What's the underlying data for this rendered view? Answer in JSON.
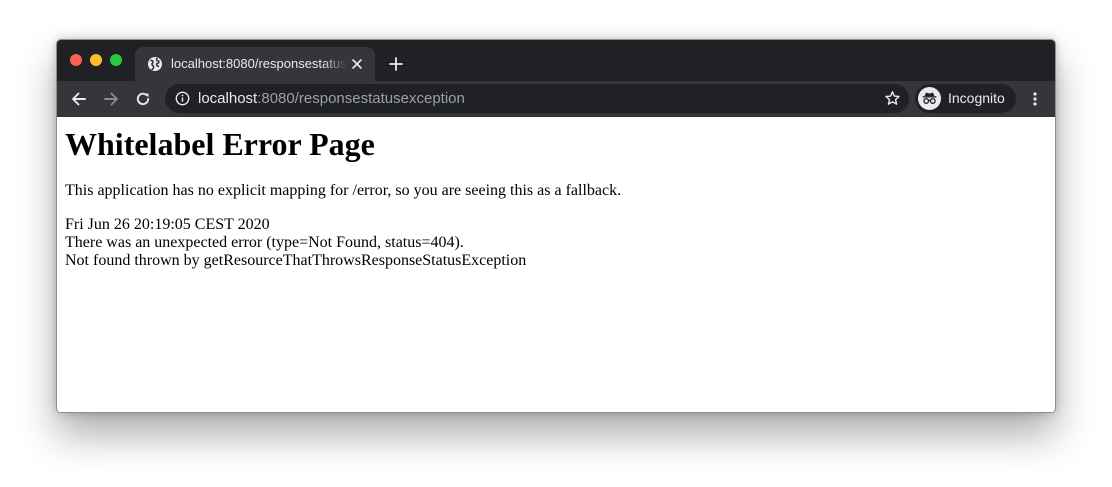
{
  "browser": {
    "tab": {
      "title": "localhost:8080/responsestatusexception",
      "favicon": "globe-icon"
    },
    "address_bar": {
      "host": "localhost",
      "path": ":8080/responsestatusexception"
    },
    "profile": {
      "label": "Incognito",
      "icon": "incognito-icon"
    },
    "colors": {
      "tabstrip": "#202124",
      "toolbar": "#35363a",
      "text": "#e8eaed",
      "muted_text": "#9aa0a6",
      "close": "#fe5f57",
      "minimize": "#febc2e",
      "maximize": "#28c840"
    }
  },
  "page": {
    "heading": "Whitelabel Error Page",
    "message": "This application has no explicit mapping for /error, so you are seeing this as a fallback.",
    "timestamp": "Fri Jun 26 20:19:05 CEST 2020",
    "error_line": "There was an unexpected error (type=Not Found, status=404).",
    "detail_line": "Not found thrown by getResourceThatThrowsResponseStatusException"
  }
}
